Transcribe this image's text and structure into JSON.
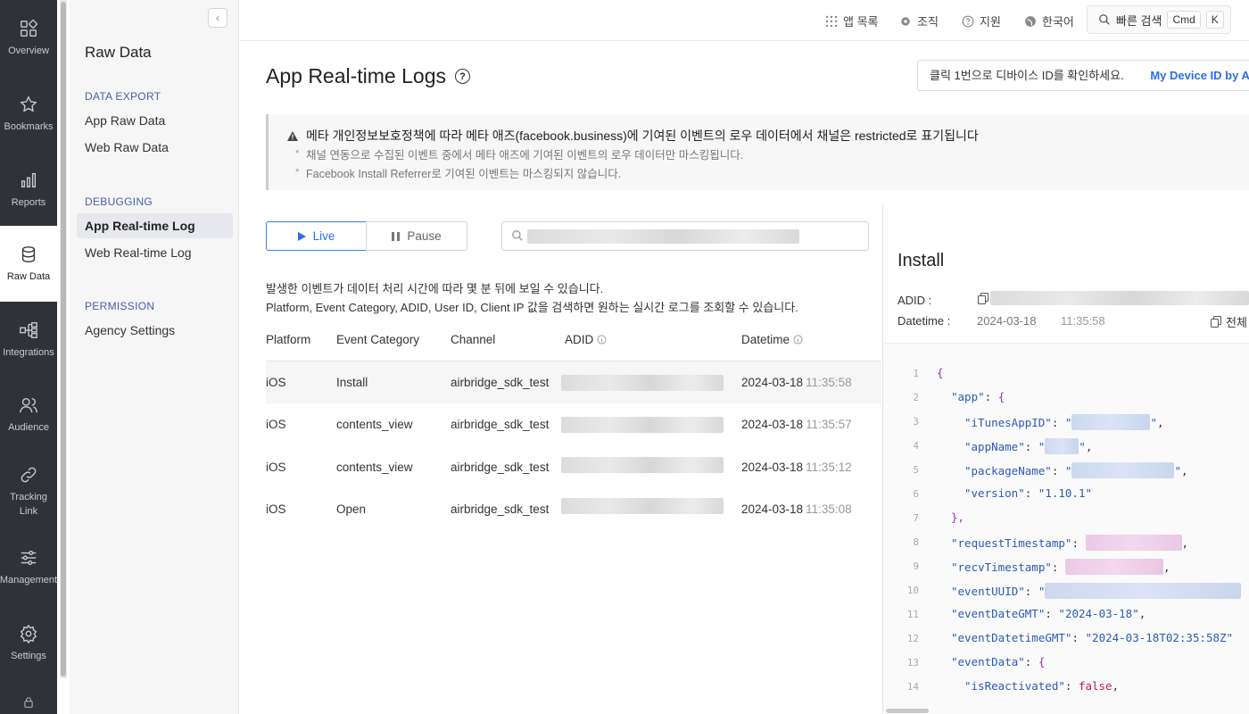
{
  "rail": {
    "items": [
      {
        "label": "Overview",
        "icon": "overview-icon"
      },
      {
        "label": "Bookmarks",
        "icon": "star-icon"
      },
      {
        "label": "Reports",
        "icon": "bar-chart-icon"
      },
      {
        "label": "Raw Data",
        "icon": "database-icon",
        "active": true
      },
      {
        "label": "Integrations",
        "icon": "integrations-icon"
      },
      {
        "label": "Audience",
        "icon": "audience-icon"
      },
      {
        "label": "Tracking Link",
        "icon": "link-icon"
      },
      {
        "label": "Management",
        "icon": "sliders-icon"
      },
      {
        "label": "Settings",
        "icon": "gear-icon"
      }
    ]
  },
  "sidebar": {
    "title": "Raw Data",
    "sections": [
      {
        "heading": "DATA EXPORT",
        "items": [
          "App Raw Data",
          "Web Raw Data"
        ]
      },
      {
        "heading": "DEBUGGING",
        "items": [
          "App Real-time Log",
          "Web Real-time Log"
        ]
      },
      {
        "heading": "PERMISSION",
        "items": [
          "Agency Settings"
        ]
      }
    ],
    "active_item": "App Real-time Log"
  },
  "topbar": {
    "app_list": "앱 목록",
    "org": "조직",
    "support": "지원",
    "language": "한국어",
    "quick_search": "빠른 검색",
    "kbd_cmd": "Cmd",
    "kbd_k": "K"
  },
  "page": {
    "title": "App Real-time Logs",
    "device_hint": "클릭 1번으로 디바이스 ID를 확인하세요.",
    "device_link": "My Device ID by Airbridge"
  },
  "notice": {
    "heading": "메타 개인정보보호정책에 따라 메타 애즈(facebook.business)에 기여된 이벤트의 로우 데이터에서 채널은 restricted로 표기됩니다",
    "lines": [
      "채널 연동으로 수집된 이벤트 중에서 메타 애즈에 기여된 이벤트의 로우 데이터만 마스킹됩니다.",
      "Facebook Install Referrer로 기여된 이벤트는 마스킹되지 않습니다."
    ]
  },
  "controls": {
    "live": "Live",
    "pause": "Pause"
  },
  "hints": [
    "발생한 이벤트가 데이터 처리 시간에 따라 몇 분 뒤에 보일 수 있습니다.",
    "Platform, Event Category, ADID, User ID, Client IP 값을 검색하면 원하는 실시간 로그를 조회할 수 있습니다."
  ],
  "table": {
    "columns": [
      "Platform",
      "Event Category",
      "Channel",
      "ADID",
      "Datetime"
    ],
    "rows": [
      {
        "platform": "iOS",
        "category": "Install",
        "channel": "airbridge_sdk_test",
        "date": "2024-03-18",
        "time": "11:35:58"
      },
      {
        "platform": "iOS",
        "category": "contents_view",
        "channel": "airbridge_sdk_test",
        "date": "2024-03-18",
        "time": "11:35:57"
      },
      {
        "platform": "iOS",
        "category": "contents_view",
        "channel": "airbridge_sdk_test",
        "date": "2024-03-18",
        "time": "11:35:12"
      },
      {
        "platform": "iOS",
        "category": "Open",
        "channel": "airbridge_sdk_test",
        "date": "2024-03-18",
        "time": "11:35:08"
      }
    ]
  },
  "detail": {
    "title": "Install",
    "adid_label": "ADID :",
    "datetime_label": "Datetime :",
    "date": "2024-03-18",
    "time": "11:35:58",
    "copy_all": "전체",
    "json": {
      "l1": "{",
      "app_key": "\"app\"",
      "itunes_key": "\"iTunesAppID\"",
      "appname_key": "\"appName\"",
      "package_key": "\"packageName\"",
      "version_key": "\"version\"",
      "version_val": "\"1.10.1\"",
      "close_app": "},",
      "reqts_key": "\"requestTimestamp\"",
      "recvts_key": "\"recvTimestamp\"",
      "uuid_key": "\"eventUUID\"",
      "dategmt_key": "\"eventDateGMT\"",
      "dategmt_val": "\"2024-03-18\"",
      "dtgmt_key": "\"eventDatetimeGMT\"",
      "dtgmt_val": "\"2024-03-18T02:35:58Z\"",
      "edata_key": "\"eventData\"",
      "react_key": "\"isReactivated\"",
      "react_val": "false"
    }
  }
}
